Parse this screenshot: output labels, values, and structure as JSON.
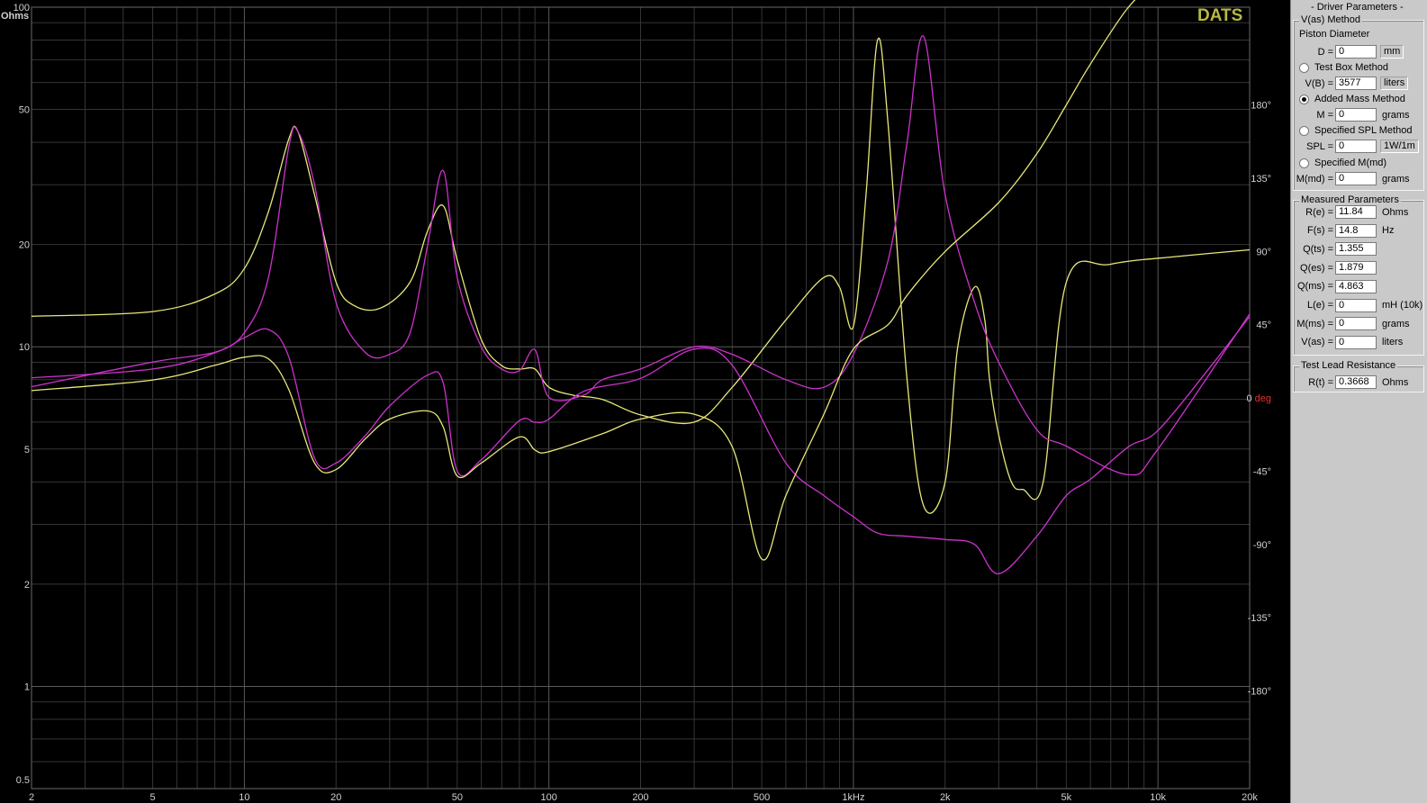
{
  "brand": "DATS",
  "chart_data": {
    "type": "line",
    "x_scale": "log",
    "y_scale": "log",
    "xlim": [
      2,
      20000
    ],
    "ylim": [
      0.5,
      100
    ],
    "y2lim": [
      -240,
      240
    ],
    "x_ticks": [
      {
        "value": 2,
        "label": "2"
      },
      {
        "value": 5,
        "label": "5"
      },
      {
        "value": 10,
        "label": "10"
      },
      {
        "value": 20,
        "label": "20"
      },
      {
        "value": 50,
        "label": "50"
      },
      {
        "value": 100,
        "label": "100"
      },
      {
        "value": 200,
        "label": "200"
      },
      {
        "value": 500,
        "label": "500"
      },
      {
        "value": 1000,
        "label": "1kHz"
      },
      {
        "value": 2000,
        "label": "2k"
      },
      {
        "value": 5000,
        "label": "5k"
      },
      {
        "value": 10000,
        "label": "10k"
      },
      {
        "value": 20000,
        "label": "20k"
      }
    ],
    "y_ticks": [
      {
        "value": 100,
        "label": "100"
      },
      {
        "value": 50,
        "label": "50"
      },
      {
        "value": 20,
        "label": "20"
      },
      {
        "value": 10,
        "label": "10"
      },
      {
        "value": 5,
        "label": "5"
      },
      {
        "value": 2,
        "label": "2"
      },
      {
        "value": 1,
        "label": "1"
      },
      {
        "value": 0.5,
        "label": "0.5"
      }
    ],
    "y2_ticks": [
      {
        "value": 180,
        "label": "180°"
      },
      {
        "value": 135,
        "label": "135°"
      },
      {
        "value": 90,
        "label": "90°"
      },
      {
        "value": 45,
        "label": "45°"
      },
      {
        "value": 0,
        "label": "0 ",
        "unit": "deg"
      },
      {
        "value": -45,
        "label": "-45°"
      },
      {
        "value": -90,
        "label": "-90°"
      },
      {
        "value": -135,
        "label": "-135°"
      },
      {
        "value": -180,
        "label": "-180°"
      }
    ],
    "ylabel": "Ohms",
    "colors": {
      "yellow": "#e8e87a",
      "magenta": "#cc33cc",
      "ohms_label": "#3a4cff",
      "deg_label": "#e83030"
    },
    "series": [
      {
        "axis": "left",
        "color": "#e8e87a",
        "points": [
          [
            2,
            12.3
          ],
          [
            5,
            12.7
          ],
          [
            8,
            14.3
          ],
          [
            10,
            17
          ],
          [
            12,
            25
          ],
          [
            14,
            41
          ],
          [
            15,
            43
          ],
          [
            17,
            28
          ],
          [
            20,
            15.5
          ],
          [
            23,
            13.2
          ],
          [
            28,
            13.0
          ],
          [
            35,
            15.5
          ],
          [
            40,
            22
          ],
          [
            45,
            26
          ],
          [
            50,
            18
          ],
          [
            60,
            10.5
          ],
          [
            70,
            8.8
          ],
          [
            80,
            8.6
          ],
          [
            90,
            8.6
          ],
          [
            100,
            7.6
          ],
          [
            120,
            7.2
          ],
          [
            150,
            7.0
          ],
          [
            200,
            6.3
          ],
          [
            300,
            6.0
          ],
          [
            400,
            7.6
          ],
          [
            600,
            12
          ],
          [
            800,
            16
          ],
          [
            900,
            15
          ],
          [
            1000,
            11.5
          ],
          [
            1100,
            28
          ],
          [
            1200,
            80
          ],
          [
            1300,
            45
          ],
          [
            1500,
            8
          ],
          [
            1700,
            3.4
          ],
          [
            2000,
            4.0
          ],
          [
            2200,
            10
          ],
          [
            2500,
            15
          ],
          [
            2700,
            12
          ],
          [
            2800,
            8
          ],
          [
            3000,
            5.5
          ],
          [
            3300,
            4.0
          ],
          [
            3600,
            3.8
          ],
          [
            4200,
            4.0
          ],
          [
            5000,
            15.5
          ],
          [
            7000,
            17.5
          ],
          [
            12000,
            18.5
          ],
          [
            20000,
            19.3
          ]
        ]
      },
      {
        "axis": "left",
        "color": "#cc33cc",
        "points": [
          [
            2,
            8.1
          ],
          [
            5,
            8.6
          ],
          [
            8,
            9.6
          ],
          [
            10,
            11
          ],
          [
            12,
            16
          ],
          [
            14,
            39
          ],
          [
            15,
            43
          ],
          [
            17,
            30
          ],
          [
            20,
            13.5
          ],
          [
            25,
            9.6
          ],
          [
            30,
            9.5
          ],
          [
            35,
            11
          ],
          [
            40,
            20
          ],
          [
            45,
            33
          ],
          [
            50,
            16
          ],
          [
            60,
            10
          ],
          [
            70,
            8.6
          ],
          [
            80,
            8.5
          ],
          [
            90,
            9.8
          ],
          [
            100,
            7.1
          ],
          [
            130,
            7.2
          ],
          [
            150,
            8.0
          ],
          [
            200,
            8.6
          ],
          [
            300,
            10.0
          ],
          [
            400,
            9.5
          ],
          [
            600,
            8.0
          ],
          [
            800,
            7.6
          ],
          [
            1000,
            9.5
          ],
          [
            1300,
            18
          ],
          [
            1500,
            40
          ],
          [
            1700,
            82
          ],
          [
            2000,
            28
          ],
          [
            2500,
            13.5
          ],
          [
            3000,
            9
          ],
          [
            4000,
            5.7
          ],
          [
            5000,
            5.1
          ],
          [
            8000,
            4.2
          ],
          [
            10000,
            5
          ],
          [
            20000,
            12.5
          ]
        ]
      },
      {
        "axis": "right",
        "color": "#cc33cc",
        "points": [
          [
            2,
            6.9
          ],
          [
            5,
            22
          ],
          [
            8,
            28
          ],
          [
            10,
            37
          ],
          [
            12,
            42
          ],
          [
            14,
            25
          ],
          [
            17,
            -37
          ],
          [
            20,
            -40
          ],
          [
            25,
            -23
          ],
          [
            30,
            -5
          ],
          [
            40,
            14
          ],
          [
            45,
            9
          ],
          [
            50,
            -45
          ],
          [
            60,
            -38
          ],
          [
            80,
            -14
          ],
          [
            90,
            -15
          ],
          [
            100,
            -13
          ],
          [
            130,
            4
          ],
          [
            200,
            12
          ],
          [
            300,
            30
          ],
          [
            400,
            20
          ],
          [
            600,
            -40
          ],
          [
            800,
            -60
          ],
          [
            1000,
            -73
          ],
          [
            1200,
            -83
          ],
          [
            1500,
            -85
          ],
          [
            2000,
            -87
          ],
          [
            2500,
            -90
          ],
          [
            3000,
            -108
          ],
          [
            4000,
            -85
          ],
          [
            5000,
            -60
          ],
          [
            6000,
            -50
          ],
          [
            8000,
            -30
          ],
          [
            10000,
            -20
          ],
          [
            15000,
            20
          ],
          [
            20000,
            50
          ]
        ]
      },
      {
        "axis": "right",
        "color": "#e8e87a",
        "points": [
          [
            2,
            4.5
          ],
          [
            5,
            11
          ],
          [
            8,
            20
          ],
          [
            10,
            25
          ],
          [
            12,
            24
          ],
          [
            14,
            5
          ],
          [
            17,
            -40
          ],
          [
            20,
            -44
          ],
          [
            25,
            -25
          ],
          [
            30,
            -13
          ],
          [
            40,
            -8
          ],
          [
            45,
            -18
          ],
          [
            50,
            -48
          ],
          [
            60,
            -40
          ],
          [
            80,
            -24
          ],
          [
            90,
            -32
          ],
          [
            100,
            -33
          ],
          [
            150,
            -22
          ],
          [
            200,
            -13
          ],
          [
            300,
            -10
          ],
          [
            400,
            -30
          ],
          [
            500,
            -99
          ],
          [
            600,
            -60
          ],
          [
            800,
            -10
          ],
          [
            1000,
            30
          ],
          [
            1300,
            45
          ],
          [
            1500,
            63
          ],
          [
            2000,
            90
          ],
          [
            3000,
            120
          ],
          [
            4000,
            150
          ],
          [
            5000,
            180
          ],
          [
            6000,
            205
          ],
          [
            8000,
            240
          ],
          [
            10000,
            255
          ],
          [
            15000,
            272
          ],
          [
            20000,
            282
          ]
        ]
      }
    ]
  },
  "panel": {
    "title": "- Driver Parameters -",
    "vas_method": {
      "title": "V(as) Method",
      "piston_label": "Piston Diameter",
      "d_label": "D =",
      "d_value": "0",
      "d_unit": "mm",
      "testbox_label": "Test Box Method",
      "vb_label": "V(B) =",
      "vb_value": "3577",
      "vb_unit": "liters",
      "addedmass_label": "Added Mass Method",
      "m_label": "M =",
      "m_value": "0",
      "m_unit": "grams",
      "spl_method_label": "Specified SPL Method",
      "spl_label": "SPL =",
      "spl_value": "0",
      "spl_unit": "1W/1m",
      "mmd_method_label": "Specified M(md)",
      "mmd_label": "M(md) =",
      "mmd_value": "0",
      "mmd_unit": "grams",
      "selected": "Added Mass Method"
    },
    "measured": {
      "title": "Measured Parameters",
      "rows": [
        {
          "label": "R(e) =",
          "value": "11.84",
          "unit": "Ohms"
        },
        {
          "label": "F(s) =",
          "value": "14.8",
          "unit": "Hz"
        },
        {
          "label": "Q(ts) =",
          "value": "1.355",
          "unit": ""
        },
        {
          "label": "Q(es) =",
          "value": "1.879",
          "unit": ""
        },
        {
          "label": "Q(ms) =",
          "value": "4.863",
          "unit": ""
        },
        {
          "label": "L(e) =",
          "value": "0",
          "unit": "mH (10k)"
        },
        {
          "label": "M(ms) =",
          "value": "0",
          "unit": "grams"
        },
        {
          "label": "V(as) =",
          "value": "0",
          "unit": "liters"
        }
      ]
    },
    "lead": {
      "title": "Test Lead Resistance",
      "label": "R(t) =",
      "value": "0.3668",
      "unit": "Ohms"
    }
  }
}
